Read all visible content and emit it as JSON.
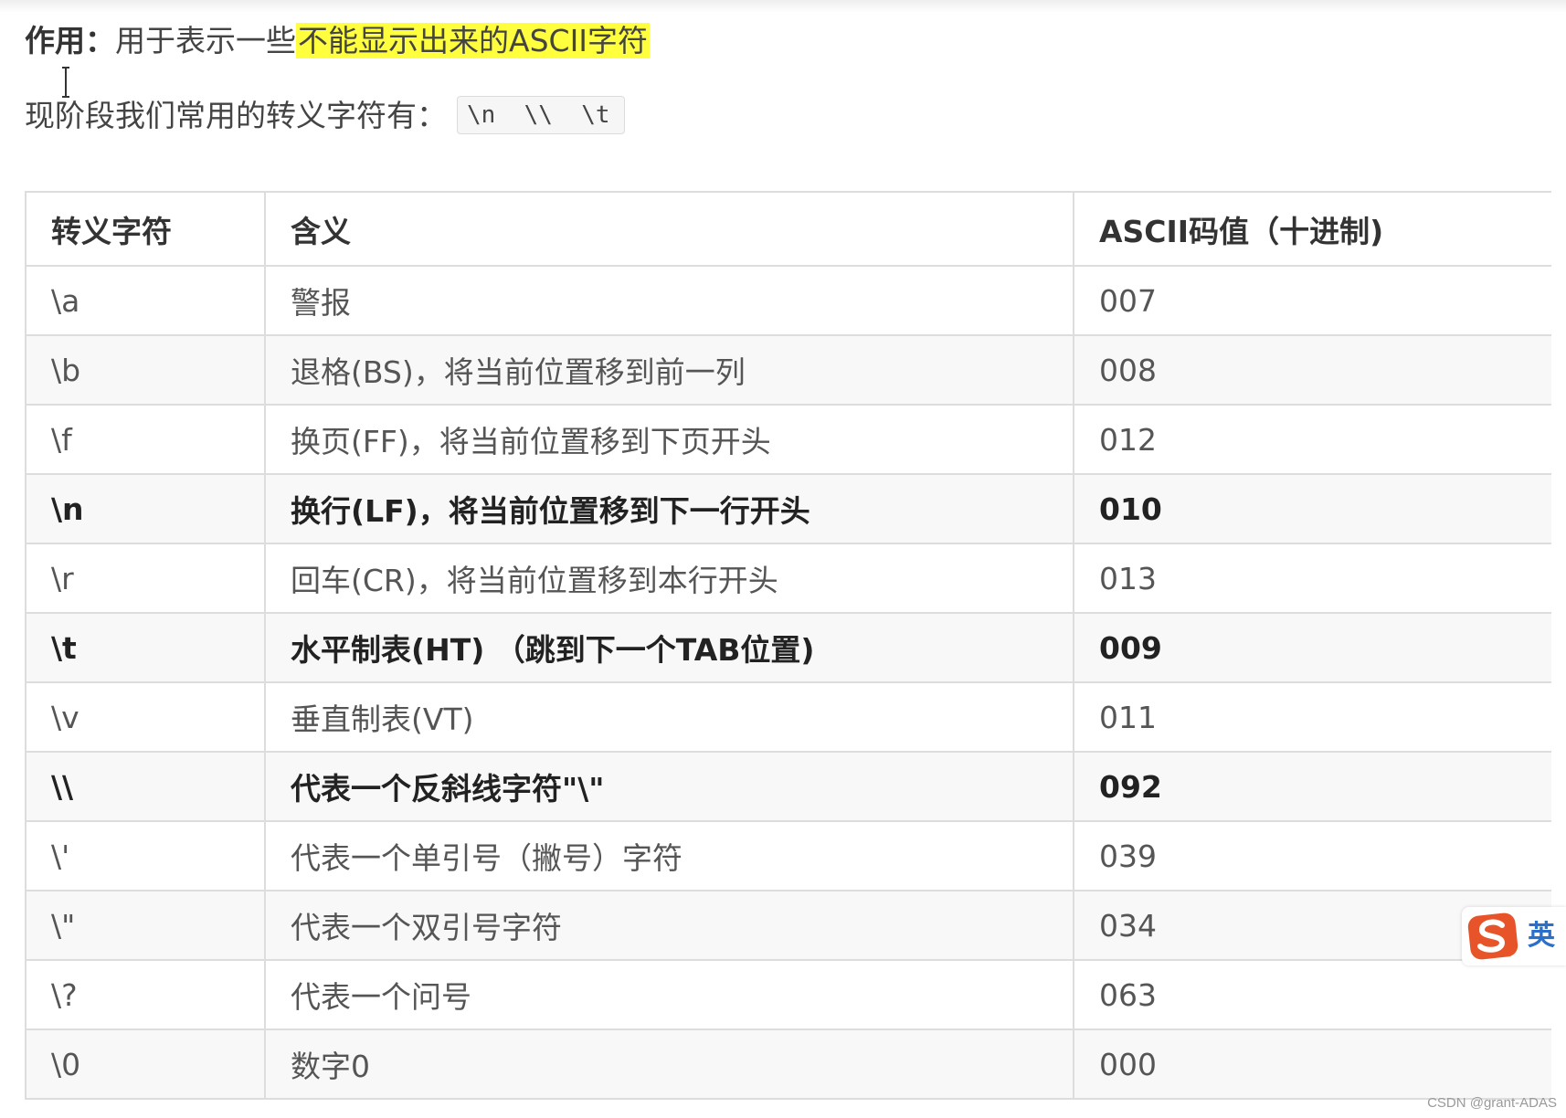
{
  "intro": {
    "purpose_label": "作用：",
    "purpose_text": "用于表示一些",
    "purpose_highlight": "不能显示出来的ASCII字符",
    "common_label": "现阶段我们常用的转义字符有：",
    "common_code": "\\n  \\\\  \\t"
  },
  "table": {
    "headers": [
      "转义字符",
      "含义",
      "ASCII码值（十进制)"
    ],
    "rows": [
      {
        "esc": "\\a",
        "meaning": "警报",
        "ascii": "007",
        "bold": false
      },
      {
        "esc": "\\b",
        "meaning": "退格(BS)，将当前位置移到前一列",
        "ascii": "008",
        "bold": false
      },
      {
        "esc": "\\f",
        "meaning": "换页(FF)，将当前位置移到下页开头",
        "ascii": "012",
        "bold": false
      },
      {
        "esc": "\\n",
        "meaning": "换行(LF)，将当前位置移到下一行开头",
        "ascii": "010",
        "bold": true
      },
      {
        "esc": "\\r",
        "meaning": "回车(CR)，将当前位置移到本行开头",
        "ascii": "013",
        "bold": false
      },
      {
        "esc": "\\t",
        "meaning": "水平制表(HT) （跳到下一个TAB位置)",
        "ascii": "009",
        "bold": true
      },
      {
        "esc": "\\v",
        "meaning": "垂直制表(VT)",
        "ascii": "011",
        "bold": false
      },
      {
        "esc": "\\\\",
        "meaning": "代表一个反斜线字符\"\\\"",
        "ascii": "092",
        "bold": true
      },
      {
        "esc": "\\'",
        "meaning": "代表一个单引号（撇号）字符",
        "ascii": "039",
        "bold": false
      },
      {
        "esc": "\\\"",
        "meaning": "代表一个双引号字符",
        "ascii": "034",
        "bold": false
      },
      {
        "esc": "\\?",
        "meaning": "代表一个问号",
        "ascii": "063",
        "bold": false
      },
      {
        "esc": "\\0",
        "meaning": "数字0",
        "ascii": "000",
        "bold": false
      }
    ]
  },
  "ime": {
    "text": "英",
    "icon": "sogou-logo-icon",
    "color": "#e8542a"
  },
  "watermark": "CSDN @grant-ADAS",
  "colors": {
    "highlight": "#ffff3d",
    "border": "#dddddd",
    "stripe": "#f8f8f8"
  }
}
